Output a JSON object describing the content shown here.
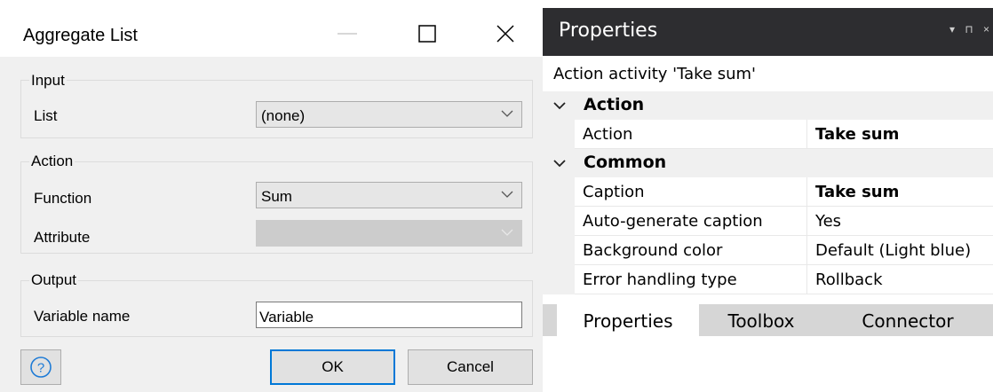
{
  "dialog": {
    "title": "Aggregate List",
    "groups": {
      "input": {
        "label": "Input",
        "list_label": "List",
        "list_value": "(none)"
      },
      "action": {
        "label": "Action",
        "function_label": "Function",
        "function_value": "Sum",
        "attribute_label": "Attribute",
        "attribute_value": ""
      },
      "output": {
        "label": "Output",
        "variable_label": "Variable name",
        "variable_value": "Variable"
      }
    },
    "buttons": {
      "help": "?",
      "ok": "OK",
      "cancel": "Cancel"
    }
  },
  "properties": {
    "title": "Properties",
    "header_icons": "▾ ⊓ ×",
    "subtitle": "Action activity 'Take sum'",
    "categories": [
      {
        "label": "Action",
        "rows": [
          {
            "name": "Action",
            "value": "Take sum"
          }
        ]
      },
      {
        "label": "Common",
        "rows": [
          {
            "name": "Caption",
            "value": "Take sum"
          },
          {
            "name": "Auto-generate caption",
            "value": "Yes"
          },
          {
            "name": "Background color",
            "value": "Default (Light blue)"
          },
          {
            "name": "Error handling type",
            "value": "Rollback"
          }
        ]
      }
    ],
    "tabs": [
      "Properties",
      "Toolbox",
      "Connector"
    ]
  },
  "colors": {
    "accent": "#0078d7",
    "header_bg": "#2d2d30",
    "dialog_bg": "#f0f0f0"
  }
}
